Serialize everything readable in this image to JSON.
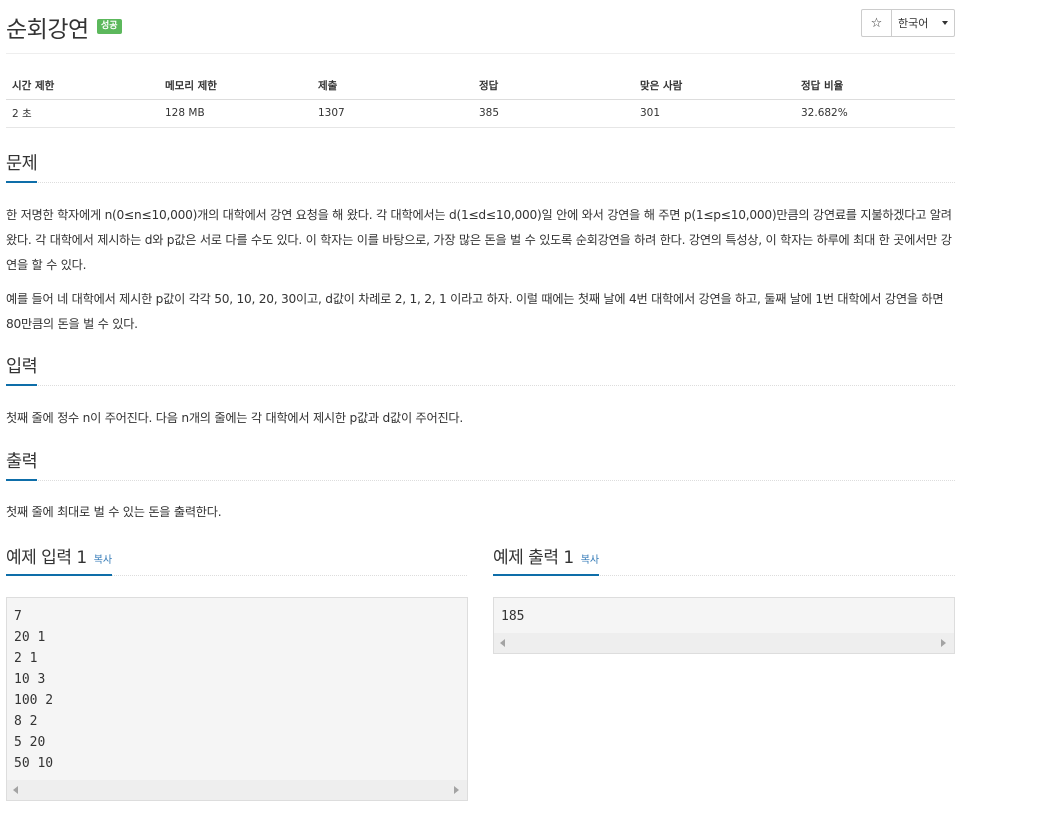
{
  "header": {
    "title": "순회강연",
    "badge": "성공",
    "star_icon": "☆",
    "language": "한국어"
  },
  "info_table": {
    "headers": [
      "시간 제한",
      "메모리 제한",
      "제출",
      "정답",
      "맞은 사람",
      "정답 비율"
    ],
    "row": [
      "2 초",
      "128 MB",
      "1307",
      "385",
      "301",
      "32.682%"
    ]
  },
  "sections": {
    "problem": {
      "title": "문제",
      "para1": "한 저명한 학자에게 n(0≤n≤10,000)개의 대학에서 강연 요청을 해 왔다. 각 대학에서는 d(1≤d≤10,000)일 안에 와서 강연을 해 주면 p(1≤p≤10,000)만큼의 강연료를 지불하겠다고 알려왔다. 각 대학에서 제시하는 d와 p값은 서로 다를 수도 있다. 이 학자는 이를 바탕으로, 가장 많은 돈을 벌 수 있도록 순회강연을 하려 한다. 강연의 특성상, 이 학자는 하루에 최대 한 곳에서만 강연을 할 수 있다.",
      "para2": "예를 들어 네 대학에서 제시한 p값이 각각 50, 10, 20, 30이고, d값이 차례로 2, 1, 2, 1 이라고 하자. 이럴 때에는 첫째 날에 4번 대학에서 강연을 하고, 둘째 날에 1번 대학에서 강연을 하면 80만큼의 돈을 벌 수 있다."
    },
    "input": {
      "title": "입력",
      "text": "첫째 줄에 정수 n이 주어진다. 다음 n개의 줄에는 각 대학에서 제시한 p값과 d값이 주어진다."
    },
    "output": {
      "title": "출력",
      "text": "첫째 줄에 최대로 벌 수 있는 돈을 출력한다."
    }
  },
  "samples": {
    "input": {
      "title": "예제 입력 1",
      "copy": "복사",
      "content": "7\n20 1\n2 1\n10 3\n100 2\n8 2\n5 20\n50 10"
    },
    "output": {
      "title": "예제 출력 1",
      "copy": "복사",
      "content": "185"
    }
  },
  "colors": {
    "accent": "#0e6ea9",
    "success": "#5cb85c",
    "link": "#337ab7"
  }
}
